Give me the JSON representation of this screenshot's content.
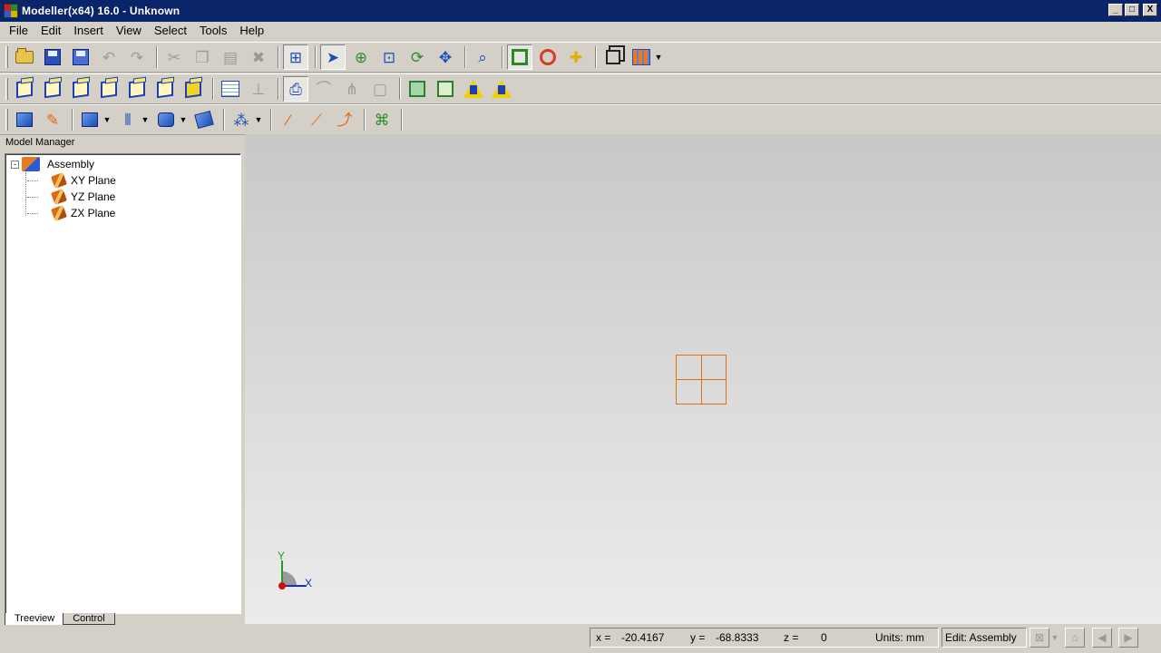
{
  "window": {
    "title": "Modeller(x64) 16.0 - Unknown",
    "buttons": {
      "minimize": "_",
      "maximize": "□",
      "close": "X"
    }
  },
  "menu": [
    "File",
    "Edit",
    "Insert",
    "View",
    "Select",
    "Tools",
    "Help"
  ],
  "toolbar1": {
    "items": [
      {
        "name": "open-icon",
        "enabled": true
      },
      {
        "name": "save-icon",
        "enabled": true
      },
      {
        "name": "save-as-icon",
        "enabled": true
      },
      {
        "name": "undo-icon",
        "enabled": false
      },
      {
        "name": "redo-icon",
        "enabled": false
      },
      {
        "name": "cut-icon",
        "enabled": false
      },
      {
        "name": "copy-icon",
        "enabled": false
      },
      {
        "name": "paste-icon",
        "enabled": false
      },
      {
        "name": "delete-icon",
        "enabled": false
      },
      {
        "name": "fit-all-icon",
        "enabled": true
      },
      {
        "name": "select-pointer-icon",
        "enabled": true,
        "pressed": true
      },
      {
        "name": "zoom-icon",
        "enabled": true
      },
      {
        "name": "zoom-window-icon",
        "enabled": true
      },
      {
        "name": "rotate-icon",
        "enabled": true
      },
      {
        "name": "pan-icon",
        "enabled": true
      },
      {
        "name": "zoom-lens-icon",
        "enabled": true
      },
      {
        "name": "box-select-icon",
        "enabled": true,
        "pressed": true
      },
      {
        "name": "circle-select-icon",
        "enabled": true
      },
      {
        "name": "polygon-select-icon",
        "enabled": true
      },
      {
        "name": "layers-icon",
        "enabled": true
      },
      {
        "name": "render-mode-icon",
        "enabled": true
      }
    ]
  },
  "toolbar2": {
    "items": [
      "view-iso-icon",
      "view-front-icon",
      "view-back-icon",
      "view-left-icon",
      "view-right-icon",
      "view-top-icon",
      "view-bottom-icon",
      "spreadsheet-icon",
      "datum-icon",
      "print-icon",
      "measure-icon",
      "dimension-icon",
      "select-filter-icon",
      "shaded-icon",
      "wireframe-icon",
      "mesh-tri-icon",
      "mesh-quad-icon"
    ]
  },
  "toolbar3": {
    "items": [
      "solid-icon",
      "paint-icon",
      "create-body-icon",
      "align-icon",
      "combine-icon",
      "transform-icon",
      "pattern-icon",
      "point-icon",
      "line-icon",
      "curve-icon",
      "tree-icon"
    ]
  },
  "model_manager": {
    "label": "Model Manager",
    "root": {
      "label": "Assembly",
      "expander": "-"
    },
    "children": [
      "XY Plane",
      "YZ Plane",
      "ZX Plane"
    ],
    "tabs": [
      {
        "label": "Treeview",
        "active": true
      },
      {
        "label": "Control",
        "active": false
      }
    ]
  },
  "viewport": {
    "axis_x": "X",
    "axis_y": "Y"
  },
  "status": {
    "x_label": "x =",
    "x_value": "-20.4167",
    "y_label": "y =",
    "y_value": "-68.8333",
    "z_label": "z =",
    "z_value": "0",
    "units": "Units: mm",
    "edit": "Edit: Assembly"
  }
}
